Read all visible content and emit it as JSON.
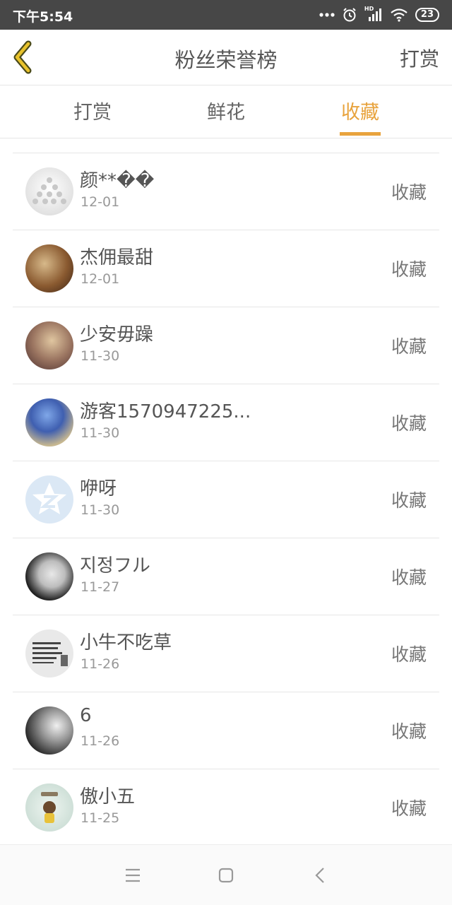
{
  "status_bar": {
    "time": "下午5:54",
    "icons": [
      "more-dots-icon",
      "alarm-icon",
      "signal-icon",
      "wifi-icon"
    ],
    "hd_label": "HD",
    "battery": "23"
  },
  "header": {
    "back_icon": "chevron-left-icon",
    "title": "粉丝荣誉榜",
    "action_label": "打赏",
    "accent_color": "#e8a33d"
  },
  "tabs": [
    {
      "label": "打赏",
      "active": false
    },
    {
      "label": "鲜花",
      "active": false
    },
    {
      "label": "收藏",
      "active": true
    }
  ],
  "list": {
    "items": [
      {
        "name": "颜**��",
        "date": "12-01",
        "action": "收藏"
      },
      {
        "name": "杰佣最甜",
        "date": "12-01",
        "action": "收藏"
      },
      {
        "name": "少安毋躁",
        "date": "11-30",
        "action": "收藏"
      },
      {
        "name": "游客1570947225...",
        "date": "11-30",
        "action": "收藏"
      },
      {
        "name": "咿呀",
        "date": "11-30",
        "action": "收藏"
      },
      {
        "name": "지정フル",
        "date": "11-27",
        "action": "收藏"
      },
      {
        "name": "小牛不吃草",
        "date": "11-26",
        "action": "收藏"
      },
      {
        "name": "6",
        "date": "11-26",
        "action": "收藏"
      },
      {
        "name": "傲小五",
        "date": "11-25",
        "action": "收藏"
      }
    ]
  },
  "nav_bar": {
    "icons": [
      "menu-icon",
      "home-square-icon",
      "back-triangle-icon"
    ]
  }
}
